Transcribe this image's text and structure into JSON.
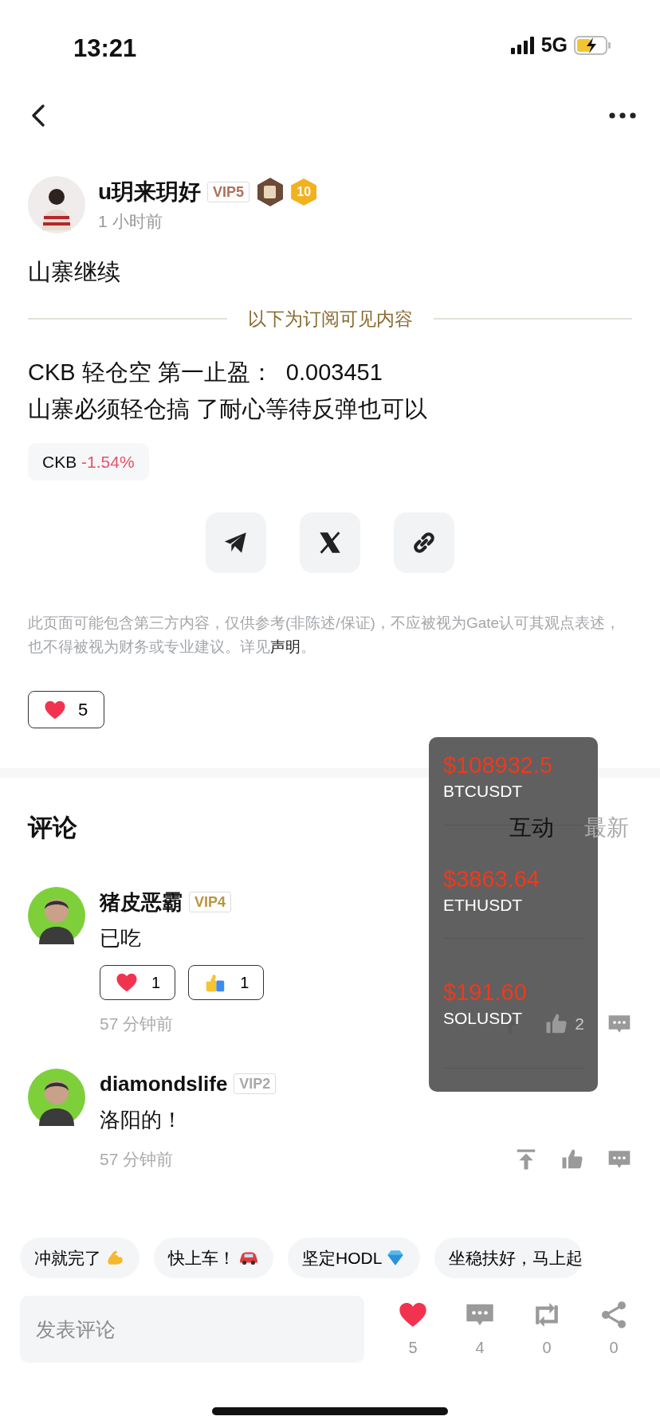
{
  "status_bar": {
    "time": "13:21",
    "network": "5G"
  },
  "post": {
    "author": {
      "name": "u玥来玥好",
      "vip": {
        "label": "VIP5",
        "color": "#b0705a"
      },
      "level": "10",
      "time": "1 小时前"
    },
    "title": "山寨继续",
    "divider_label": "以下为订阅可见内容",
    "body": [
      "CKB 轻仓空 第一止盈：  0.003451",
      "山寨必须轻仓搞 了耐心等待反弹也可以"
    ],
    "ticker": {
      "symbol": "CKB",
      "change": "-1.54%"
    },
    "disclaimer": {
      "text": "此页面可能包含第三方内容，仅供参考(非陈述/保证)，不应被视为Gate认可其观点表述，也不得被视为财务或专业建议。详见",
      "link": "声明",
      "end": "。"
    },
    "likes": "5"
  },
  "comments": {
    "title": "评论",
    "tabs": [
      {
        "label": "互动",
        "selected": true
      },
      {
        "label": "最新",
        "selected": false
      }
    ],
    "items": [
      {
        "name": "猪皮恶霸",
        "vip": {
          "label": "VIP4",
          "color": "#b8963e"
        },
        "text": "已吃",
        "reactions": [
          {
            "kind": "heart",
            "count": "1"
          },
          {
            "kind": "thumb",
            "count": "1"
          }
        ],
        "time": "57 分钟前",
        "like_count": "2"
      },
      {
        "name": "diamondslife",
        "vip": {
          "label": "VIP2",
          "color": "#a8a8a8"
        },
        "text": "洛阳的！",
        "time": "57 分钟前"
      }
    ]
  },
  "ticker_popup": [
    {
      "price": "$108932.5",
      "symbol": "BTCUSDT"
    },
    {
      "price": "$3863.64",
      "symbol": "ETHUSDT"
    },
    {
      "price": "$191.60",
      "symbol": "SOLUSDT"
    }
  ],
  "quick_replies": [
    {
      "label": "冲就完了",
      "kind": "muscle"
    },
    {
      "label": "快上车！",
      "kind": "car"
    },
    {
      "label": "坚定HODL",
      "kind": "gem"
    },
    {
      "label": "坐稳扶好，马上起"
    }
  ],
  "bottom_bar": {
    "placeholder": "发表评论",
    "liked": true,
    "likes": "5",
    "comments": "4",
    "reposts": "0",
    "shares": "0"
  }
}
